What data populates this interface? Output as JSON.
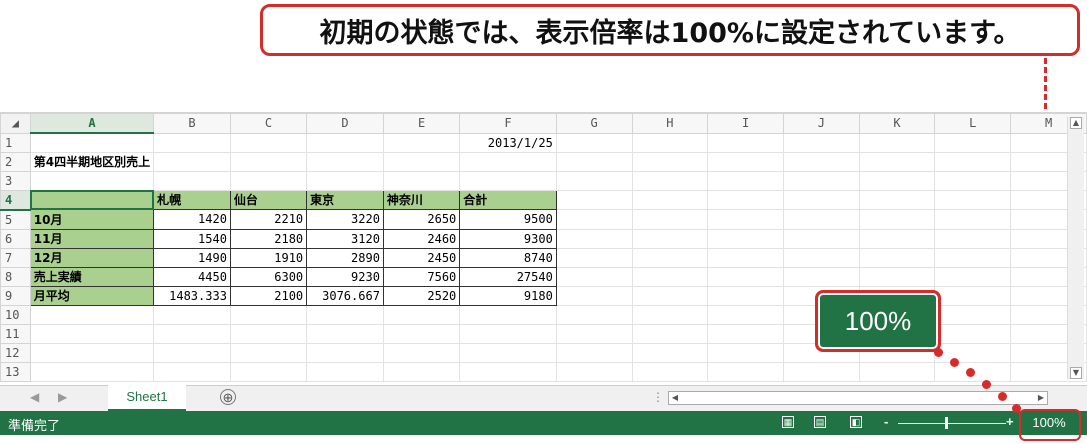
{
  "callout": "初期の状態では、表示倍率は100%に設定されています。",
  "badge": "100%",
  "columns": [
    "A",
    "B",
    "C",
    "D",
    "E",
    "F",
    "G",
    "H",
    "I",
    "J",
    "K",
    "L",
    "M"
  ],
  "rows": [
    {
      "n": "1",
      "a": "",
      "b": "",
      "c": "",
      "d": "",
      "e": "",
      "f": "2013/1/25"
    },
    {
      "n": "2",
      "a": "第4四半期地区別売上",
      "b": "",
      "c": "",
      "d": "",
      "e": "",
      "f": ""
    },
    {
      "n": "3",
      "a": "",
      "b": "",
      "c": "",
      "d": "",
      "e": "",
      "f": ""
    },
    {
      "n": "4",
      "a": "",
      "b": "札幌",
      "c": "仙台",
      "d": "東京",
      "e": "神奈川",
      "f": "合計"
    },
    {
      "n": "5",
      "a": "10月",
      "b": "1420",
      "c": "2210",
      "d": "3220",
      "e": "2650",
      "f": "9500"
    },
    {
      "n": "6",
      "a": "11月",
      "b": "1540",
      "c": "2180",
      "d": "3120",
      "e": "2460",
      "f": "9300"
    },
    {
      "n": "7",
      "a": "12月",
      "b": "1490",
      "c": "1910",
      "d": "2890",
      "e": "2450",
      "f": "8740"
    },
    {
      "n": "8",
      "a": "売上実績",
      "b": "4450",
      "c": "6300",
      "d": "9230",
      "e": "7560",
      "f": "27540"
    },
    {
      "n": "9",
      "a": "月平均",
      "b": "1483.333",
      "c": "2100",
      "d": "3076.667",
      "e": "2520",
      "f": "9180"
    },
    {
      "n": "10",
      "a": "",
      "b": "",
      "c": "",
      "d": "",
      "e": "",
      "f": ""
    },
    {
      "n": "11",
      "a": "",
      "b": "",
      "c": "",
      "d": "",
      "e": "",
      "f": ""
    },
    {
      "n": "12",
      "a": "",
      "b": "",
      "c": "",
      "d": "",
      "e": "",
      "f": ""
    },
    {
      "n": "13",
      "a": "",
      "b": "",
      "c": "",
      "d": "",
      "e": "",
      "f": ""
    }
  ],
  "sheet_tab": "Sheet1",
  "add_sheet": "⊕",
  "status": {
    "ready": "準備完了",
    "zoom": "100%",
    "minus": "-",
    "plus": "+"
  },
  "colors": {
    "excel_green": "#217346",
    "header_fill": "#a9d08e",
    "annotation_red": "#d62b2b"
  }
}
